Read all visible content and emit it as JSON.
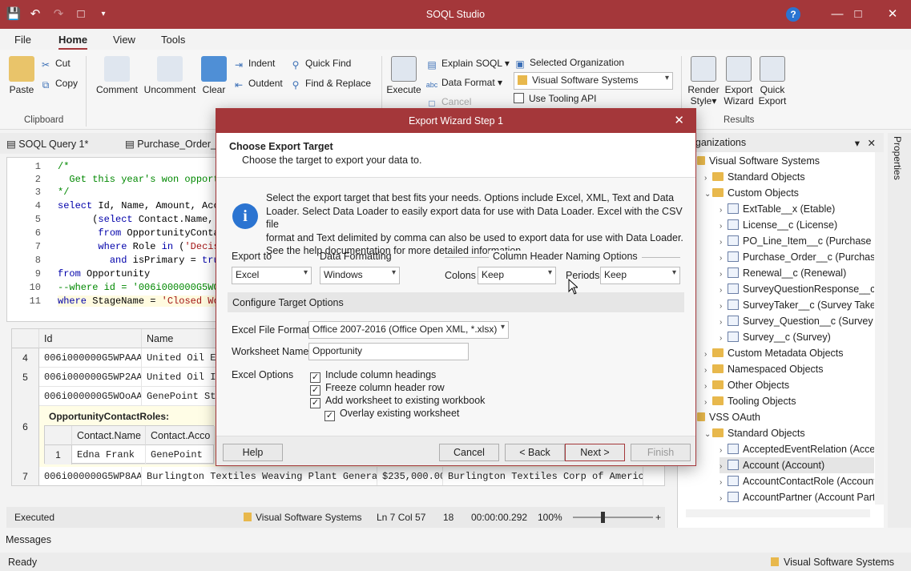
{
  "window": {
    "title": "SOQL Studio"
  },
  "qat": {
    "save_icon": "save-icon",
    "undo_icon": "undo-icon",
    "redo_icon": "redo-icon",
    "new_icon": "new-document-icon",
    "customize_icon": "chevron-down-icon"
  },
  "ribbon_tabs": [
    "File",
    "Home",
    "View",
    "Tools"
  ],
  "ribbon": {
    "paste": "Paste",
    "cut": "Cut",
    "copy": "Copy",
    "clipboard_group": "Clipboard",
    "comment": "Comment",
    "uncomment": "Uncomment",
    "clear": "Clear",
    "indent": "Indent",
    "outdent": "Outdent",
    "quick_find": "Quick Find",
    "find_replace": "Find & Replace",
    "execute": "Execute",
    "explain": "Explain SOQL",
    "data_format": "Data Format",
    "cancel": "Cancel",
    "selected_org": "Selected Organization",
    "org_value": "Visual Software Systems",
    "use_tooling": "Use Tooling API",
    "render_style_1": "Render",
    "render_style_2": "Style",
    "export_wizard_1": "Export",
    "export_wizard_2": "Wizard",
    "quick_export_1": "Quick",
    "quick_export_2": "Export",
    "results_group": "Results"
  },
  "doc_tabs": [
    "SOQL Query 1*",
    "Purchase_Order_"
  ],
  "editor": {
    "lines": [
      "1",
      "2",
      "3",
      "4",
      "5",
      "6",
      "7",
      "8",
      "9",
      "10",
      "11"
    ]
  },
  "grid": {
    "headers": [
      "Id",
      "Name"
    ],
    "rows": [
      {
        "num": "4",
        "id": "006i000000G5WPAAA3",
        "name": "United Oil Em"
      },
      {
        "num": "5",
        "id": "006i000000G5WP2AAN",
        "name": "United Oil In"
      },
      {
        "num": "",
        "id": "006i000000G5WOoAAN",
        "name": "GenePoint Sta"
      }
    ],
    "nested_label": "OpportunityContactRoles:",
    "nested_row_num": "6",
    "nested_headers": [
      "Contact.Name",
      "Contact.Acco"
    ],
    "nested_row": {
      "num": "1",
      "name": "Edna Frank",
      "acct": "GenePoint"
    },
    "last_row": {
      "num": "7",
      "id": "006i000000G5WP8AAN",
      "name": "Burlington Textiles Weaving Plant Generator",
      "amount": "$235,000.00",
      "account": "Burlington Textiles Corp of America"
    }
  },
  "status": {
    "state": "Executed",
    "org": "Visual Software Systems",
    "pos": "Ln 7 Col 57",
    "count": "18",
    "time": "00:00:00.292",
    "zoom": "100%"
  },
  "org_panel": {
    "title": "Organizations",
    "items": [
      {
        "label": "Visual Software Systems",
        "level": 0,
        "type": "org"
      },
      {
        "label": "Standard Objects",
        "level": 1,
        "type": "folder"
      },
      {
        "label": "Custom Objects",
        "level": 1,
        "type": "folder"
      },
      {
        "label": "ExtTable__x (Etable)",
        "level": 2,
        "type": "table"
      },
      {
        "label": "License__c (License)",
        "level": 2,
        "type": "table"
      },
      {
        "label": "PO_Line_Item__c (Purchase Or",
        "level": 2,
        "type": "table"
      },
      {
        "label": "Purchase_Order__c (Purchase",
        "level": 2,
        "type": "table"
      },
      {
        "label": "Renewal__c (Renewal)",
        "level": 2,
        "type": "table"
      },
      {
        "label": "SurveyQuestionResponse__c (",
        "level": 2,
        "type": "table"
      },
      {
        "label": "SurveyTaker__c (Survey Taken)",
        "level": 2,
        "type": "table"
      },
      {
        "label": "Survey_Question__c (Survey C",
        "level": 2,
        "type": "table"
      },
      {
        "label": "Survey__c (Survey)",
        "level": 2,
        "type": "table"
      },
      {
        "label": "Custom Metadata Objects",
        "level": 1,
        "type": "folder"
      },
      {
        "label": "Namespaced Objects",
        "level": 1,
        "type": "folder"
      },
      {
        "label": "Other Objects",
        "level": 1,
        "type": "folder"
      },
      {
        "label": "Tooling Objects",
        "level": 1,
        "type": "folder"
      },
      {
        "label": "VSS OAuth",
        "level": 0,
        "type": "org"
      },
      {
        "label": "Standard Objects",
        "level": 1,
        "type": "folder"
      },
      {
        "label": "AcceptedEventRelation (Accep",
        "level": 2,
        "type": "table"
      },
      {
        "label": "Account (Account)",
        "level": 2,
        "type": "table"
      },
      {
        "label": "AccountContactRole (Account",
        "level": 2,
        "type": "table"
      },
      {
        "label": "AccountPartner (Account Part",
        "level": 2,
        "type": "table"
      }
    ]
  },
  "properties_label": "Properties",
  "messages_label": "Messages",
  "footer": {
    "ready": "Ready",
    "org": "Visual Software Systems"
  },
  "dialog": {
    "title": "Export Wizard Step 1",
    "heading": "Choose Export Target",
    "subheading": "Choose the target to export your data to.",
    "info_lines": [
      "Select the export target that best fits your needs.  Options include Excel, XML, Text and Data",
      "Loader.  Select Data Loader to easily export data for use with Data Loader. Excel with the CSV file",
      "format and Text delimited by comma can also be used to export data for use with Data Loader.",
      "See the help documentation for more detailed information."
    ],
    "export_to_label": "Export to",
    "export_to": "Excel",
    "data_formatting_label": "Data Formatting",
    "data_formatting": "Windows",
    "col_header_label": "Column Header Naming Options",
    "colons_label": "Colons",
    "colons": "Keep",
    "periods_label": "Periods",
    "periods": "Keep",
    "configure_label": "Configure Target Options",
    "file_format_label": "Excel File Format",
    "file_format": "Office 2007-2016 (Office Open XML, *.xlsx)",
    "worksheet_label": "Worksheet Name",
    "worksheet": "Opportunity",
    "options_label": "Excel Options",
    "options": [
      "Include column headings",
      "Freeze column header row",
      "Add worksheet to existing workbook",
      "Overlay existing worksheet"
    ],
    "help": "Help",
    "cancel": "Cancel",
    "back": "< Back",
    "next": "Next >",
    "finish": "Finish"
  },
  "colors": {
    "brand": "#a4373a"
  }
}
